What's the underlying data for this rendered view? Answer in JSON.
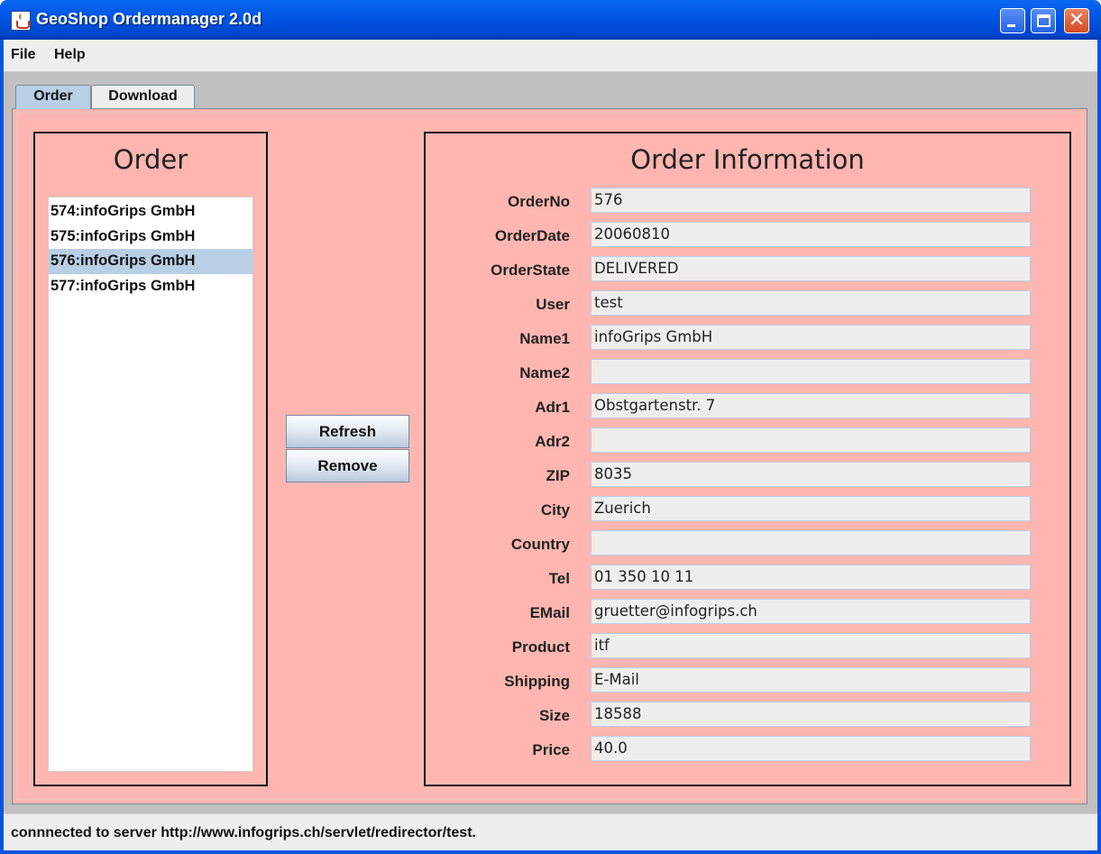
{
  "window": {
    "title": "GeoShop Ordermanager 2.0d",
    "icon": "java-cup-icon"
  },
  "menu": {
    "items": [
      {
        "label": "File"
      },
      {
        "label": "Help"
      }
    ]
  },
  "tabs": [
    {
      "label": "Order",
      "active": true
    },
    {
      "label": "Download",
      "active": false
    }
  ],
  "order_panel": {
    "heading": "Order",
    "items": [
      {
        "label": "574:infoGrips GmbH",
        "selected": false
      },
      {
        "label": "575:infoGrips GmbH",
        "selected": false
      },
      {
        "label": "576:infoGrips GmbH",
        "selected": true
      },
      {
        "label": "577:infoGrips GmbH",
        "selected": false
      }
    ]
  },
  "actions": {
    "refresh_label": "Refresh",
    "remove_label": "Remove"
  },
  "info_panel": {
    "heading": "Order Information",
    "fields": [
      {
        "label": "OrderNo",
        "value": "576"
      },
      {
        "label": "OrderDate",
        "value": "20060810"
      },
      {
        "label": "OrderState",
        "value": "DELIVERED"
      },
      {
        "label": "User",
        "value": "test"
      },
      {
        "label": "Name1",
        "value": "infoGrips GmbH"
      },
      {
        "label": "Name2",
        "value": ""
      },
      {
        "label": "Adr1",
        "value": "Obstgartenstr. 7"
      },
      {
        "label": "Adr2",
        "value": ""
      },
      {
        "label": "ZIP",
        "value": "8035"
      },
      {
        "label": "City",
        "value": "Zuerich"
      },
      {
        "label": "Country",
        "value": ""
      },
      {
        "label": "Tel",
        "value": "01 350 10 11"
      },
      {
        "label": "EMail",
        "value": "gruetter@infogrips.ch"
      },
      {
        "label": "Product",
        "value": "itf"
      },
      {
        "label": "Shipping",
        "value": "E-Mail"
      },
      {
        "label": "Size",
        "value": "18588"
      },
      {
        "label": "Price",
        "value": "40.0"
      }
    ]
  },
  "status": {
    "text": "connnected to server http://www.infogrips.ch/servlet/redirector/test."
  },
  "colors": {
    "panel_background": "#ffb6b0",
    "selection": "#b8cfe5",
    "titlebar": "#0054e3"
  }
}
